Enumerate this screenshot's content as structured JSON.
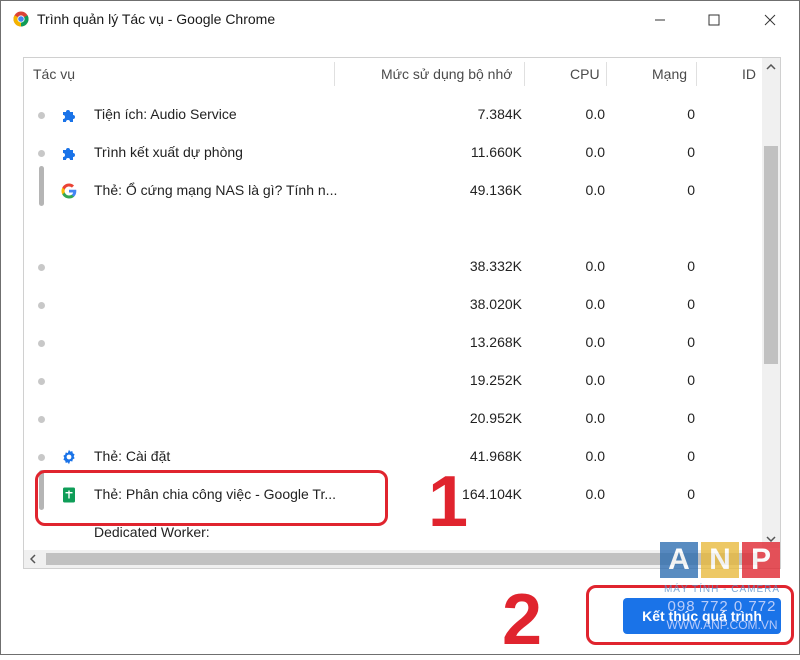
{
  "window": {
    "title": "Trình quản lý Tác vụ - Google Chrome",
    "minimize": "—",
    "maximize": "☐",
    "close": "✕"
  },
  "columns": [
    "Tác vụ",
    "Mức sử dụng bộ nhớ",
    "CPU",
    "Mạng",
    "ID"
  ],
  "rows": [
    {
      "icon": "puzzle-icon",
      "name": "Tiện ích: Audio Service",
      "memory": "7.384K",
      "cpu": "0.0",
      "network": "0"
    },
    {
      "icon": "puzzle-icon",
      "name": "Trình kết xuất dự phòng",
      "memory": "11.660K",
      "cpu": "0.0",
      "network": "0"
    },
    {
      "icon": "google-g-icon",
      "name": "Thẻ: Ổ cứng mạng NAS là gì? Tính n...",
      "memory": "49.136K",
      "cpu": "0.0",
      "network": "0"
    },
    {
      "icon": "",
      "name": "",
      "memory": "",
      "cpu": "",
      "network": ""
    },
    {
      "icon": "",
      "name": "",
      "memory": "38.332K",
      "cpu": "0.0",
      "network": "0"
    },
    {
      "icon": "",
      "name": "",
      "memory": "38.020K",
      "cpu": "0.0",
      "network": "0"
    },
    {
      "icon": "",
      "name": "",
      "memory": "13.268K",
      "cpu": "0.0",
      "network": "0"
    },
    {
      "icon": "",
      "name": "",
      "memory": "19.252K",
      "cpu": "0.0",
      "network": "0"
    },
    {
      "icon": "",
      "name": "",
      "memory": "20.952K",
      "cpu": "0.0",
      "network": "0"
    },
    {
      "icon": "gear-icon",
      "name": "Thẻ: Cài đặt",
      "memory": "41.968K",
      "cpu": "0.0",
      "network": "0"
    },
    {
      "icon": "sheets-icon",
      "name": "Thẻ: Phân chia công việc - Google Tr...",
      "memory": "164.104K",
      "cpu": "0.0",
      "network": "0"
    },
    {
      "icon": "",
      "name": "Dedicated Worker:",
      "memory": "",
      "cpu": "",
      "network": ""
    }
  ],
  "end_button": "Kết thúc quá trình",
  "annotations": {
    "one": "1",
    "two": "2"
  },
  "watermark": {
    "letters": [
      "A",
      "N",
      "P"
    ],
    "subtitle": "MÁY TÍNH - CAMERA",
    "phone": "098 772 0 772",
    "url": "WWW.ANP.COM.VN"
  },
  "colors": {
    "accent": "#1a73e8",
    "annotation": "#e0242e",
    "anp_a": "#2b6cb0",
    "anp_n": "#e8b93a",
    "anp_p": "#e0242e"
  }
}
